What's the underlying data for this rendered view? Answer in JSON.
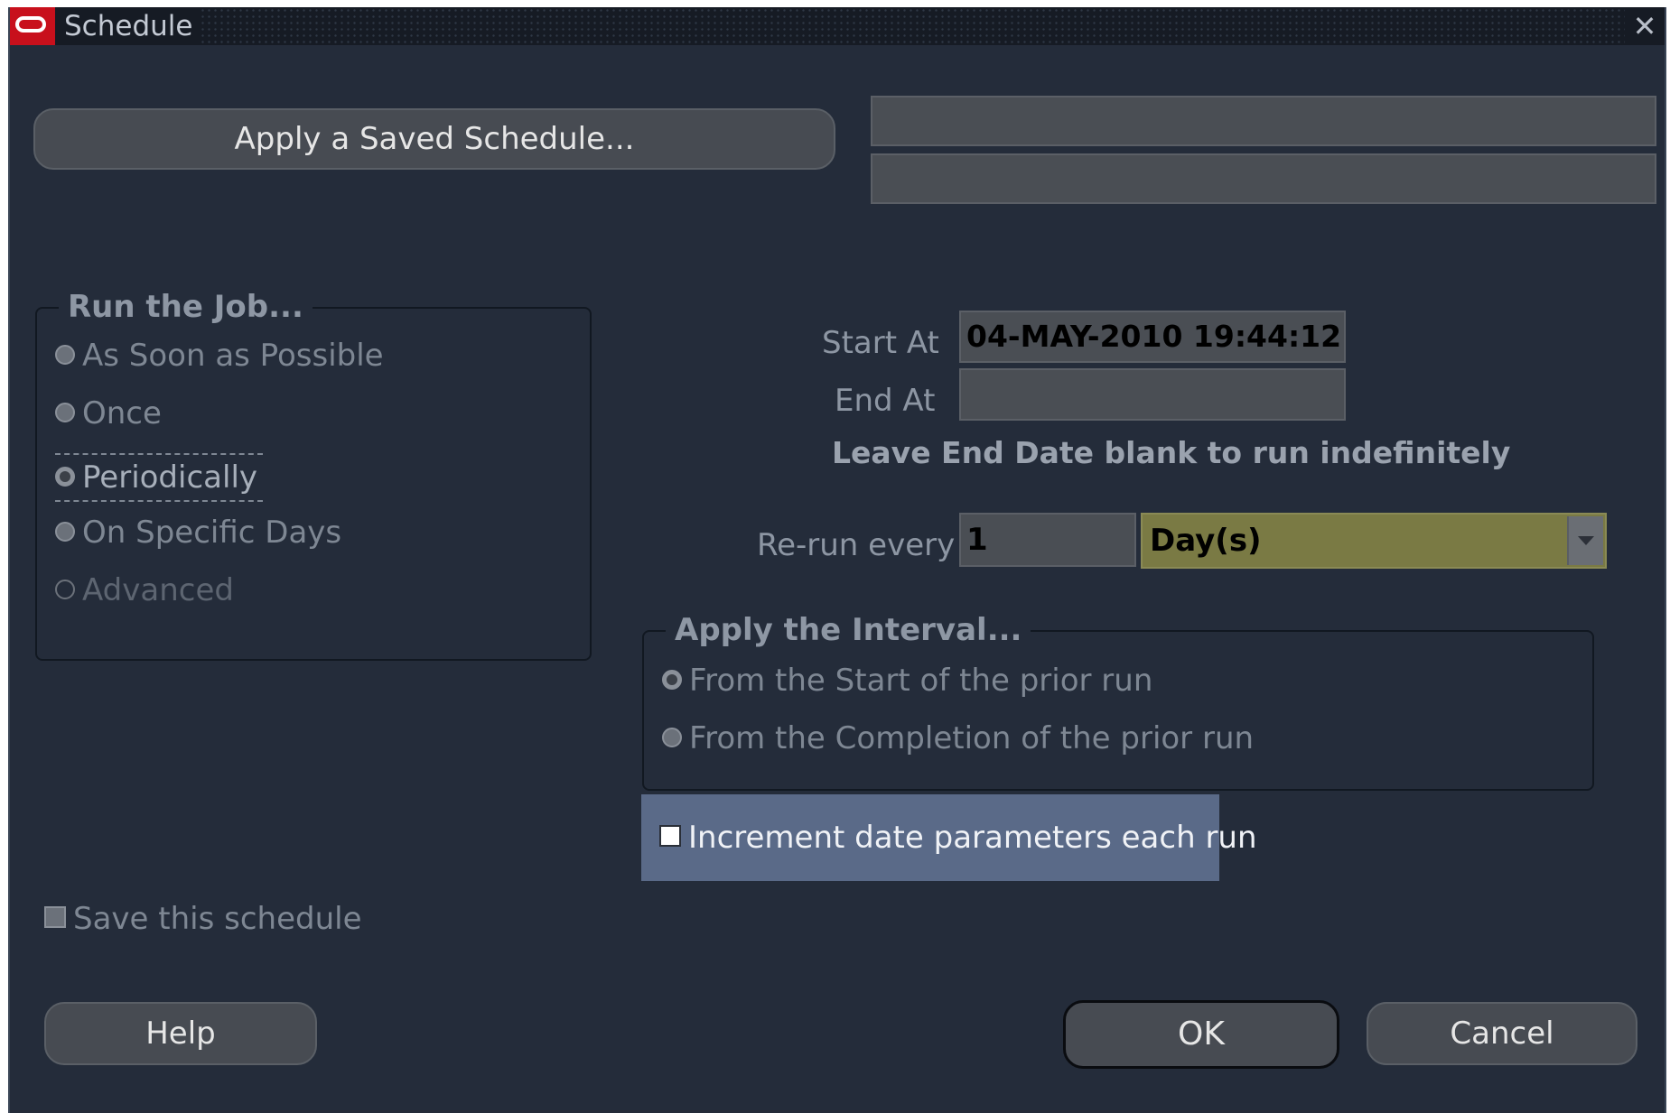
{
  "window": {
    "title": "Schedule",
    "close_glyph": "✕"
  },
  "top": {
    "apply_saved_button_label": "Apply a Saved Schedule...",
    "schedule_name_value": "",
    "schedule_desc_value": ""
  },
  "run_the_job": {
    "legend": "Run the Job...",
    "options": [
      {
        "label": "As Soon as Possible",
        "selected": false
      },
      {
        "label": "Once",
        "selected": false
      },
      {
        "label": "Periodically",
        "selected": true
      },
      {
        "label": "On Specific Days",
        "selected": false
      },
      {
        "label": "Advanced",
        "selected": false
      }
    ]
  },
  "timing": {
    "start_label": "Start At",
    "start_value": "04-MAY-2010 19:44:12",
    "end_label": "End At",
    "end_value": "",
    "end_hint": "Leave End Date blank to run indefinitely",
    "rerun_label": "Re-run every",
    "rerun_value": "1",
    "rerun_unit": "Day(s)"
  },
  "interval": {
    "legend": "Apply the Interval...",
    "options": [
      {
        "label": "From the Start of the prior run",
        "selected": true
      },
      {
        "label": "From the Completion of the prior run",
        "selected": false
      }
    ]
  },
  "increment": {
    "label": "Increment date parameters each run",
    "checked": false
  },
  "save_schedule": {
    "label": "Save this schedule",
    "checked": false
  },
  "footer": {
    "help_label": "Help",
    "ok_label": "OK",
    "cancel_label": "Cancel"
  },
  "colors": {
    "window_bg": "#242c3a",
    "title_bar": "#161b24",
    "oracle_red": "#c8101c",
    "field_bg": "#4a4e54",
    "dropdown_bg": "#7a7a44",
    "focus_highlight": "#5a6a88"
  }
}
